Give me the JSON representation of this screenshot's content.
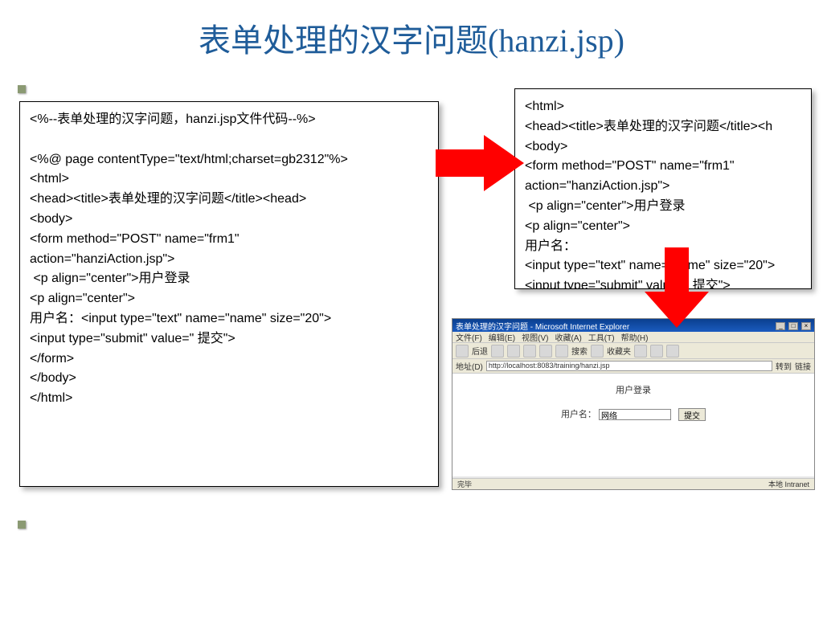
{
  "title": "表单处理的汉字问题(hanzi.jsp)",
  "left_code": "<%--表单处理的汉字问题，hanzi.jsp文件代码--%>\n\n<%@ page contentType=\"text/html;charset=gb2312\"%>\n<html>\n<head><title>表单处理的汉字问题</title><head>\n<body>\n<form method=\"POST\" name=\"frm1\"\naction=\"hanziAction.jsp\">\n <p align=\"center\">用户登录\n<p align=\"center\">\n用户名：<input type=\"text\" name=\"name\" size=\"20\">\n<input type=\"submit\" value=\" 提交\">\n</form>\n</body>\n</html>",
  "right_code": "<html>\n<head><title>表单处理的汉字问题</title><h\n<body>\n<form method=\"POST\" name=\"frm1\"\naction=\"hanziAction.jsp\">\n <p align=\"center\">用户登录\n<p align=\"center\">\n用户名：\n<input type=\"text\" name=\"name\" size=\"20\">\n<input type=\"submit\" value=\" 提交\">\n</form></body></html>",
  "browser": {
    "window_title": "表单处理的汉字问题 - Microsoft Internet Explorer",
    "menu": [
      "文件(F)",
      "编辑(E)",
      "视图(V)",
      "收藏(A)",
      "工具(T)",
      "帮助(H)"
    ],
    "toolbar_labels": [
      "后退",
      "搜索",
      "收藏夹"
    ],
    "addr_label": "地址(D)",
    "url": "http://localhost:8083/training/hanzi.jsp",
    "go_label": "转到",
    "links_label": "链接",
    "page_heading": "用户登录",
    "field_label": "用户名：",
    "field_value": "网络",
    "submit_label": "提交",
    "status_done": "完毕",
    "status_zone": "本地 Intranet"
  }
}
